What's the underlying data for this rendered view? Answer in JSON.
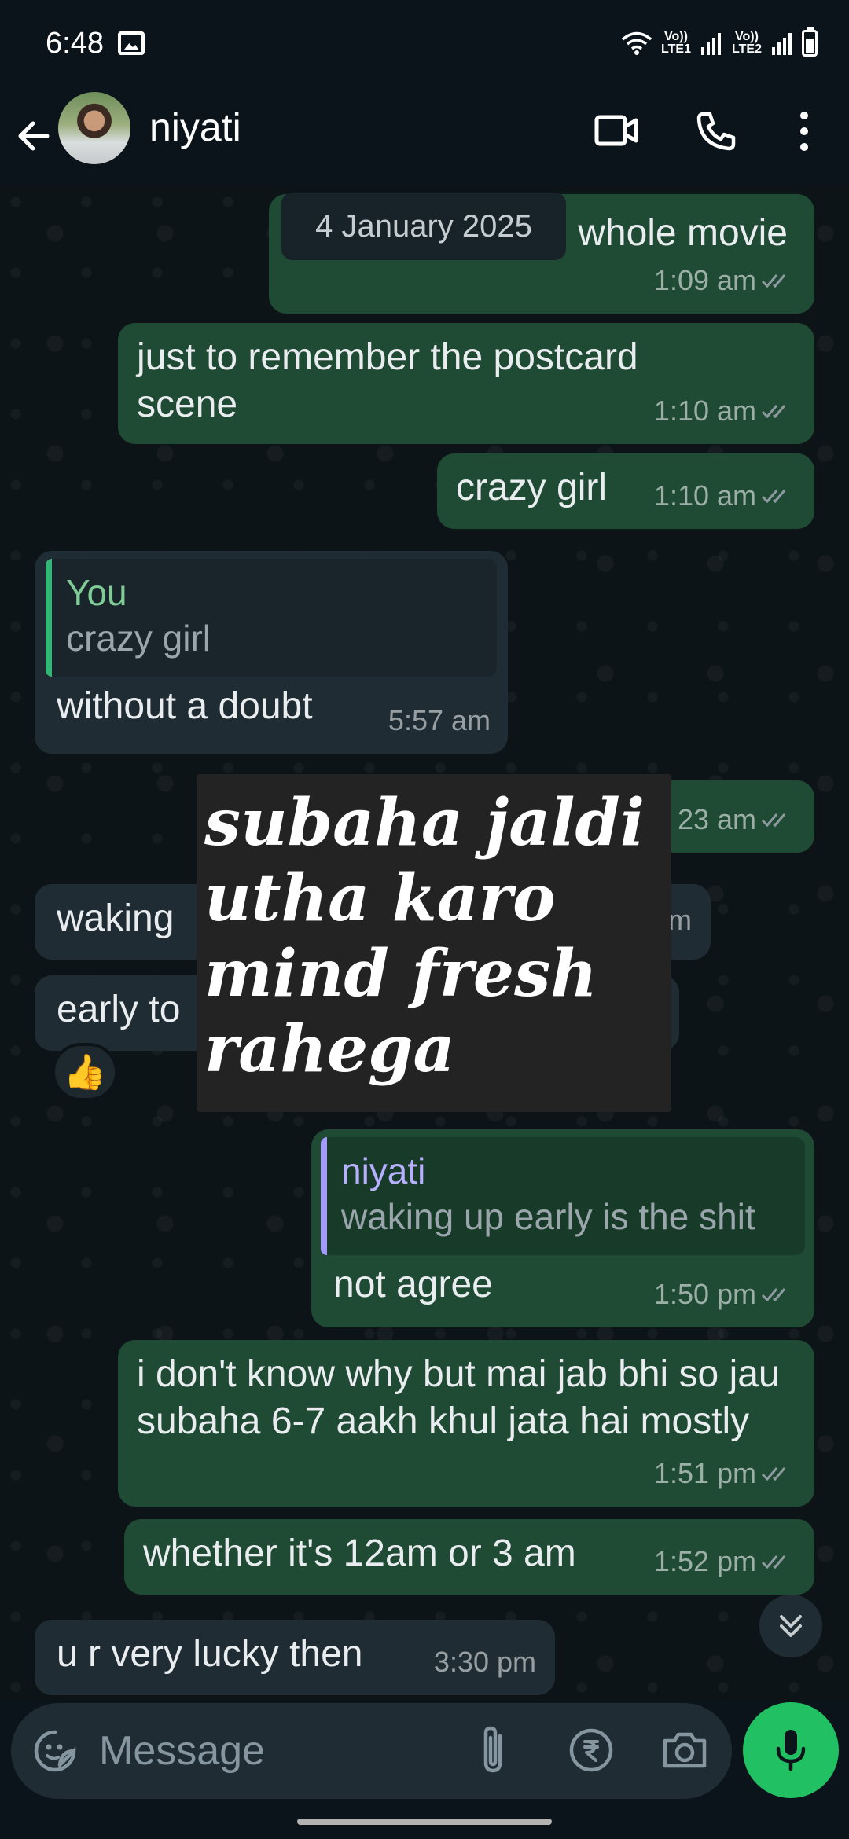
{
  "status_bar": {
    "time": "6:48",
    "sim1_label": "Vo)) LTE1",
    "sim2_label": "Vo)) LTE2"
  },
  "header": {
    "contact_name": "niyati",
    "icons": [
      "back-arrow-icon",
      "video-call-icon",
      "voice-call-icon",
      "more-options-icon"
    ]
  },
  "date_chip": "4 January 2025",
  "messages": [
    {
      "direction": "out",
      "text": "whole movie",
      "time": "1:09 am",
      "status": "read"
    },
    {
      "direction": "out",
      "text": "just to remember the postcard scene",
      "time": "1:10 am",
      "status": "read"
    },
    {
      "direction": "out",
      "text": "crazy girl",
      "time": "1:10 am",
      "status": "read"
    },
    {
      "direction": "in",
      "quote_author": "You",
      "quote_text": "crazy girl",
      "text": "without a doubt",
      "time": "5:57 am"
    },
    {
      "direction": "out",
      "time": "23 am",
      "status": "read"
    },
    {
      "direction": "in",
      "text": "waking",
      "time": "m"
    },
    {
      "direction": "in",
      "text": "early to",
      "reaction": "👍"
    },
    {
      "direction": "out",
      "quote_author": "niyati",
      "quote_text": "waking up early is the shit",
      "text": "not agree",
      "time": "1:50 pm",
      "status": "read"
    },
    {
      "direction": "out",
      "text": "i don't know why but mai jab bhi so jau subaha 6-7 aakh khul jata hai mostly",
      "time": "1:51 pm",
      "status": "read"
    },
    {
      "direction": "out",
      "text": "whether it's 12am or 3 am",
      "time": "1:52 pm",
      "status": "read"
    },
    {
      "direction": "in",
      "text": "u r very lucky then",
      "time": "3:30 pm"
    }
  ],
  "sticker": {
    "lines": [
      "subaha jaldi",
      "utha karo",
      "mind fresh",
      "rahega"
    ]
  },
  "composer": {
    "placeholder": "Message",
    "icons": [
      "emoji-sticker-icon",
      "attach-icon",
      "rupee-payment-icon",
      "camera-icon",
      "mic-icon"
    ]
  },
  "colors": {
    "background": "#0b141a",
    "outgoing_bubble": "#1f4a34",
    "incoming_bubble": "#202c33",
    "accent_green": "#21c063",
    "read_tick": "#8c9a9f"
  }
}
